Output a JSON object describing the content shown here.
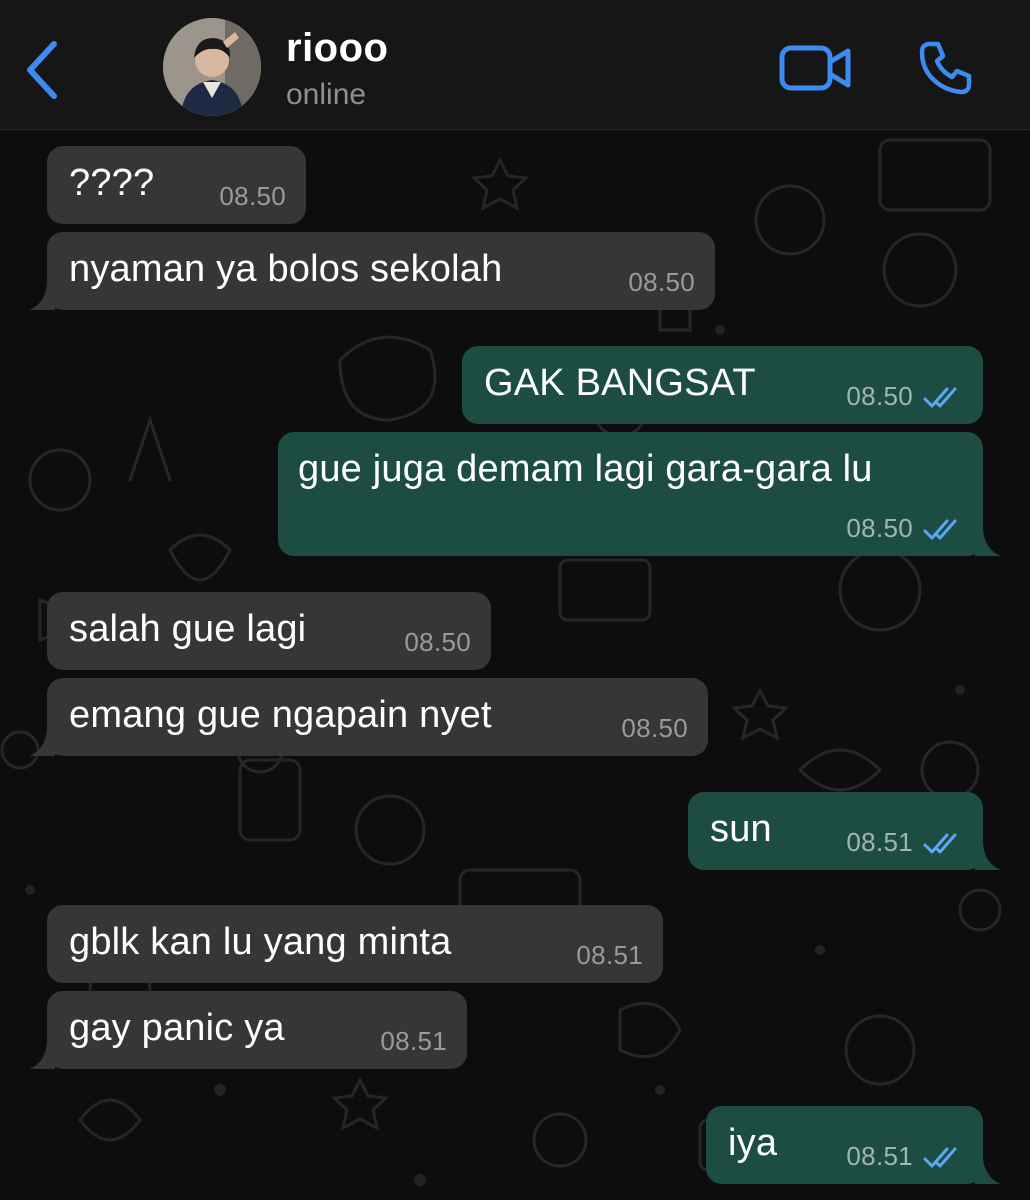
{
  "header": {
    "contact_name": "riooo",
    "status": "online",
    "back_icon": "chevron-left-icon",
    "video_icon": "video-camera-icon",
    "call_icon": "phone-icon",
    "accent_color": "#3c8bf0"
  },
  "colors": {
    "incoming_bubble": "#363636",
    "outgoing_bubble": "#1d4d42",
    "read_ticks": "#5aa8f5",
    "background": "#0d0d0d"
  },
  "messages": [
    {
      "direction": "in",
      "text": "????",
      "time": "08.50"
    },
    {
      "direction": "in",
      "text": "nyaman ya bolos sekolah",
      "time": "08.50"
    },
    {
      "direction": "out",
      "text": "GAK BANGSAT",
      "time": "08.50",
      "status": "read"
    },
    {
      "direction": "out",
      "text": "gue juga demam lagi gara-gara lu",
      "time": "08.50",
      "status": "read"
    },
    {
      "direction": "in",
      "text": "salah gue lagi",
      "time": "08.50"
    },
    {
      "direction": "in",
      "text": "emang gue ngapain nyet",
      "time": "08.50"
    },
    {
      "direction": "out",
      "text": "sun",
      "time": "08.51",
      "status": "read"
    },
    {
      "direction": "in",
      "text": "gblk kan lu yang minta",
      "time": "08.51"
    },
    {
      "direction": "in",
      "text": "gay panic ya",
      "time": "08.51"
    },
    {
      "direction": "out",
      "text": "iya",
      "time": "08.51",
      "status": "read"
    }
  ]
}
